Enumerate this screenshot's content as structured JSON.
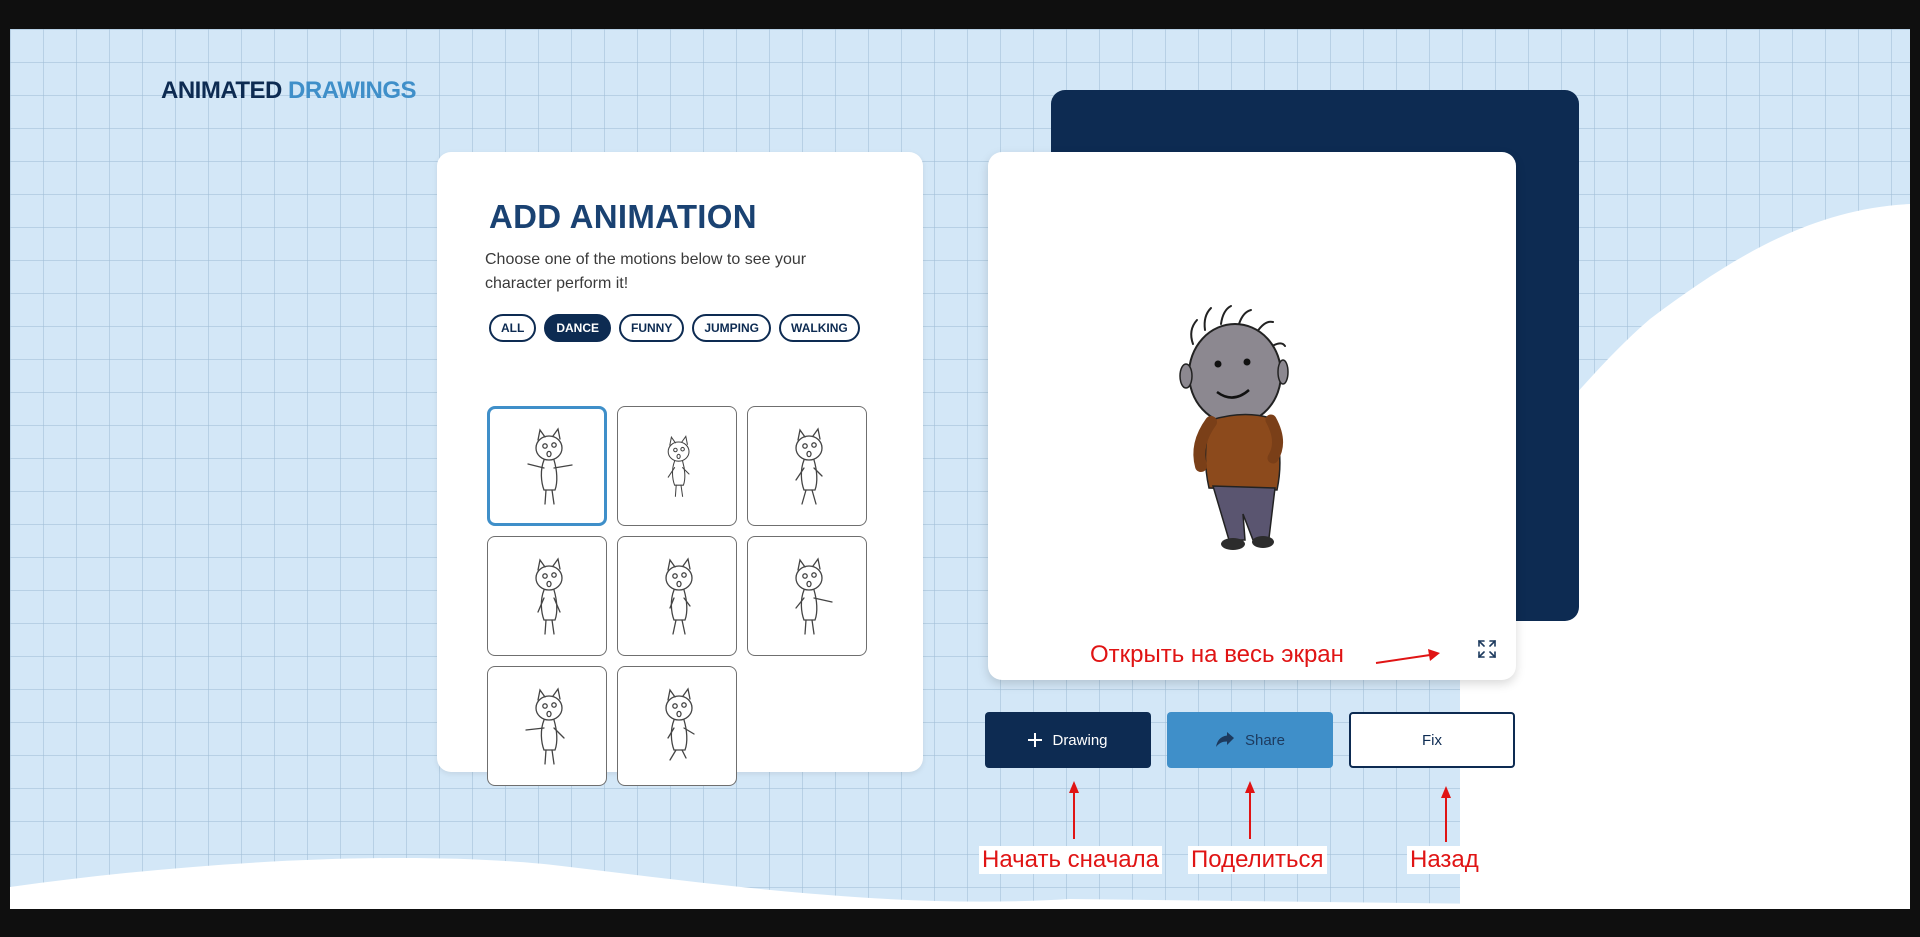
{
  "app": {
    "logo_part1": "ANIMATED",
    "logo_part2": "DRAWINGS"
  },
  "panel": {
    "title": "ADD ANIMATION",
    "description": "Choose one of the motions below to see your character perform it!",
    "filters": [
      {
        "label": "ALL",
        "active": false
      },
      {
        "label": "DANCE",
        "active": true
      },
      {
        "label": "FUNNY",
        "active": false
      },
      {
        "label": "JUMPING",
        "active": false
      },
      {
        "label": "WALKING",
        "active": false
      }
    ],
    "motion_count": 8,
    "selected_motion": 1
  },
  "preview": {
    "fullscreen_icon": "expand-icon"
  },
  "actions": {
    "drawing_label": "Drawing",
    "drawing_icon": "plus-icon",
    "share_label": "Share",
    "share_icon": "share-arrow-icon",
    "fix_label": "Fix"
  },
  "annotations": {
    "fullscreen": "Открыть на весь экран",
    "restart": "Начать сначала",
    "share": "Поделиться",
    "back": "Назад"
  },
  "colors": {
    "navy": "#0d2b52",
    "accent_blue": "#3f8fc9",
    "background": "#d3e7f7",
    "annotation_red": "#e01414"
  }
}
